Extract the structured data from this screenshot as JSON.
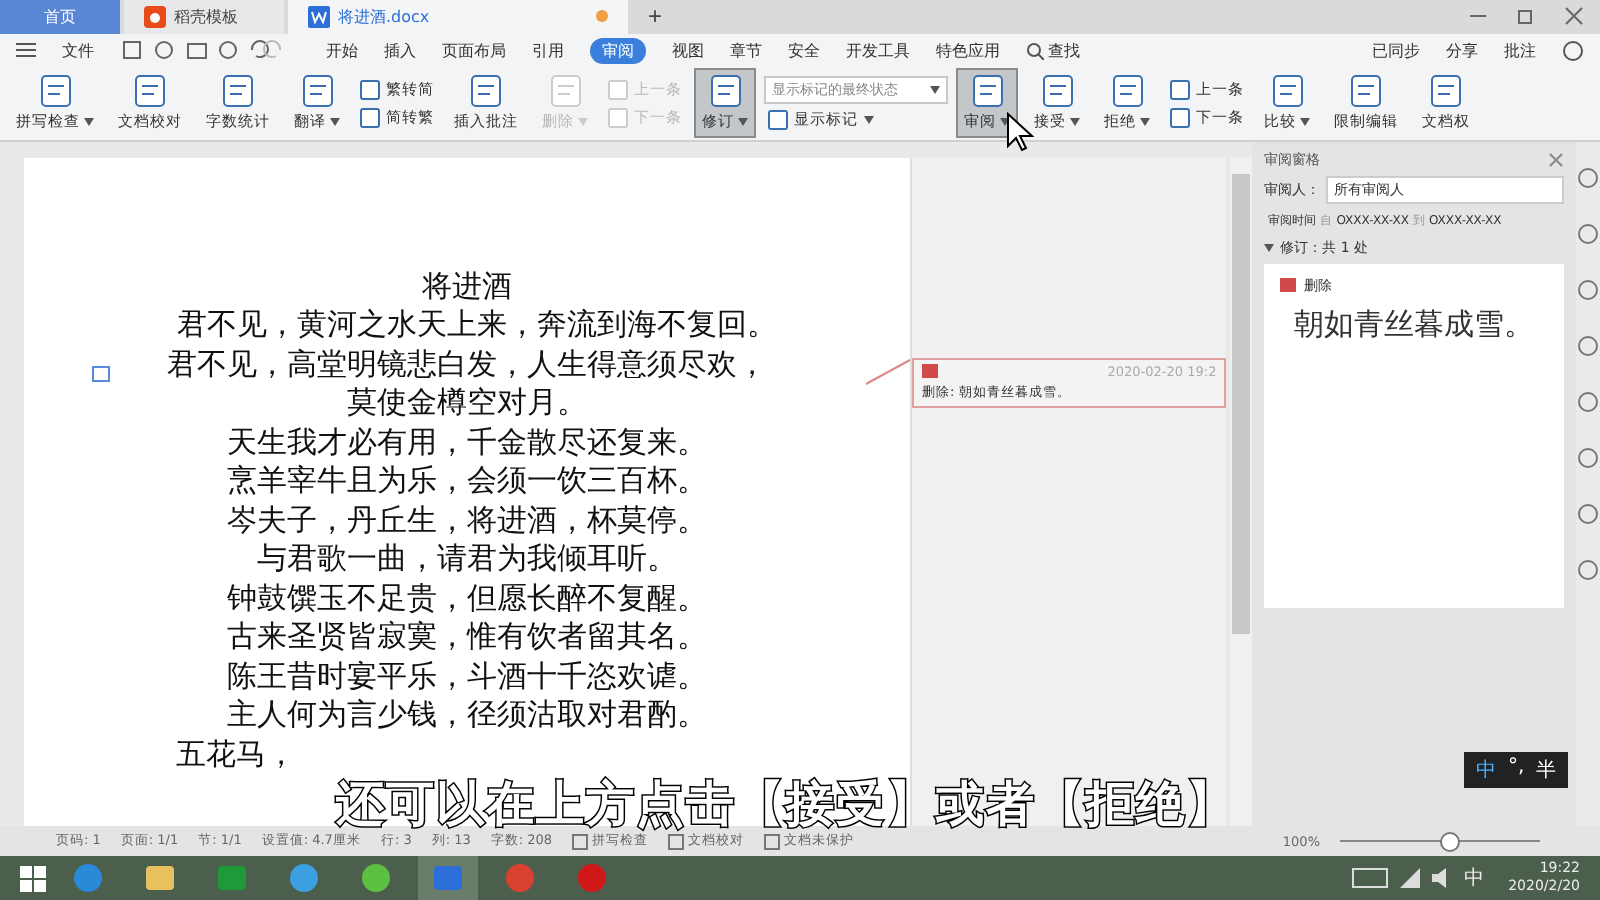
{
  "tabs": [
    {
      "label": "首页",
      "kind": "home",
      "selected": false
    },
    {
      "label": "稻壳模板",
      "kind": "template",
      "selected": false
    },
    {
      "label": "将进酒.docx",
      "kind": "doc",
      "selected": true
    }
  ],
  "new_tab": "+",
  "menu": {
    "file": "文件",
    "items": [
      {
        "label": "开始",
        "selected": false
      },
      {
        "label": "插入",
        "selected": false
      },
      {
        "label": "页面布局",
        "selected": false
      },
      {
        "label": "引用",
        "selected": false
      },
      {
        "label": "审阅",
        "selected": true
      },
      {
        "label": "视图",
        "selected": false
      },
      {
        "label": "章节",
        "selected": false
      },
      {
        "label": "安全",
        "selected": false
      },
      {
        "label": "开发工具",
        "selected": false
      },
      {
        "label": "特色应用",
        "selected": false
      }
    ],
    "search": "查找",
    "right": [
      "已同步",
      "分享",
      "批注"
    ]
  },
  "ribbon": [
    {
      "items": [
        {
          "label": "拼写检查",
          "kind": "big",
          "caret": true,
          "disabled": false,
          "selected": false
        }
      ]
    },
    {
      "items": [
        {
          "label": "文档校对",
          "kind": "big",
          "caret": false,
          "disabled": false,
          "selected": false
        }
      ]
    },
    {
      "items": [
        {
          "label": "字数统计",
          "kind": "big",
          "caret": false,
          "disabled": false,
          "selected": false
        }
      ]
    },
    {
      "items": [
        {
          "label": "翻译",
          "kind": "big",
          "caret": true,
          "disabled": false,
          "selected": false
        }
      ]
    },
    {
      "items": [
        {
          "label": "繁转简",
          "kind": "small",
          "caret": false,
          "disabled": false
        },
        {
          "label": "简转繁",
          "kind": "small",
          "caret": false,
          "disabled": false
        }
      ]
    },
    {
      "items": [
        {
          "label": "插入批注",
          "kind": "big",
          "caret": false,
          "disabled": false,
          "selected": false
        }
      ]
    },
    {
      "items": [
        {
          "label": "删除",
          "kind": "big",
          "caret": true,
          "disabled": true,
          "selected": false
        }
      ]
    },
    {
      "items": [
        {
          "label": "上一条",
          "kind": "small",
          "caret": false,
          "disabled": true
        },
        {
          "label": "下一条",
          "kind": "small",
          "caret": false,
          "disabled": true
        }
      ]
    },
    {
      "items": [
        {
          "label": "修订",
          "kind": "big",
          "caret": true,
          "disabled": false,
          "selected": true
        }
      ]
    },
    {
      "items": [
        {
          "label": "显示标记的最终状态",
          "kind": "select",
          "caret": true,
          "disabled": false
        },
        {
          "label": "显示标记",
          "kind": "small",
          "caret": true,
          "disabled": false
        }
      ]
    },
    {
      "items": [
        {
          "label": "审阅",
          "kind": "big",
          "caret": true,
          "disabled": false,
          "selected": true
        }
      ]
    },
    {
      "items": [
        {
          "label": "接受",
          "kind": "big",
          "caret": true,
          "disabled": false,
          "selected": false
        }
      ]
    },
    {
      "items": [
        {
          "label": "拒绝",
          "kind": "big",
          "caret": true,
          "disabled": false,
          "selected": false
        }
      ]
    },
    {
      "items": [
        {
          "label": "上一条",
          "kind": "small",
          "caret": false,
          "disabled": false
        },
        {
          "label": "下一条",
          "kind": "small",
          "caret": false,
          "disabled": false
        }
      ]
    },
    {
      "items": [
        {
          "label": "比较",
          "kind": "big",
          "caret": true,
          "disabled": false,
          "selected": false
        }
      ]
    },
    {
      "items": [
        {
          "label": "限制编辑",
          "kind": "big",
          "caret": false,
          "disabled": false,
          "selected": false
        }
      ]
    },
    {
      "items": [
        {
          "label": "文档权",
          "kind": "big",
          "caret": false,
          "disabled": false,
          "selected": false
        }
      ]
    }
  ],
  "document": {
    "title": "将进酒",
    "lines": [
      "君不见，黄河之水天上来，奔流到海不复回。",
      "君不见，高堂明镜悲白发，人生得意须尽欢，",
      "莫使金樽空对月。",
      "天生我才必有用，千金散尽还复来。",
      "烹羊宰牛且为乐，会须一饮三百杯。",
      "岑夫子，丹丘生，将进酒，杯莫停。",
      "与君歌一曲，请君为我倾耳听。",
      "钟鼓馔玉不足贵，但愿长醉不复醒。",
      "古来圣贤皆寂寞，惟有饮者留其名。",
      "陈王昔时宴平乐，斗酒十千恣欢谑。",
      "主人何为言少钱，径须沽取对君酌。",
      "五花马，"
    ],
    "comment": {
      "date": "2020-02-20 19:2",
      "text": "删除: 朝如青丝暮成雪。"
    }
  },
  "review_pane": {
    "title": "审阅窗格",
    "reviewer_label": "审阅人：",
    "reviewer": "所有审阅人",
    "time_label": "审阅时间",
    "from": "自",
    "from_value": "OXXX-XX-XX",
    "to": "到",
    "to_value": "OXXX-XX-XX",
    "summary": "修订：共 1 处",
    "change_type": "删除",
    "change_text": "朝如青丝暮成雪。"
  },
  "status_bar": {
    "items": [
      "页码: 1",
      "页面: 1/1",
      "节: 1/1",
      "设置值: 4.7厘米",
      "行: 3",
      "列: 13",
      "字数: 208"
    ],
    "checks": [
      "拼写检查",
      "文档校对",
      "文档未保护"
    ],
    "zoom": "100%",
    "zoom_slider": {
      "level": 0.55
    }
  },
  "ime": {
    "mode": "中",
    "punct": "°,",
    "width": "半"
  },
  "taskbar": {
    "apps": [
      {
        "kind": "ie",
        "selected": false
      },
      {
        "kind": "folder",
        "selected": false
      },
      {
        "kind": "store",
        "selected": false
      },
      {
        "kind": "cloud",
        "selected": false
      },
      {
        "kind": "green",
        "selected": false
      },
      {
        "kind": "wps",
        "selected": true
      },
      {
        "kind": "chrome",
        "selected": false
      },
      {
        "kind": "record",
        "selected": false
      }
    ],
    "tray_ime": "中",
    "time": "19:22",
    "date": "2020/2/20"
  },
  "subtitle": "还可以在上方点击【接受】或者【拒绝】"
}
